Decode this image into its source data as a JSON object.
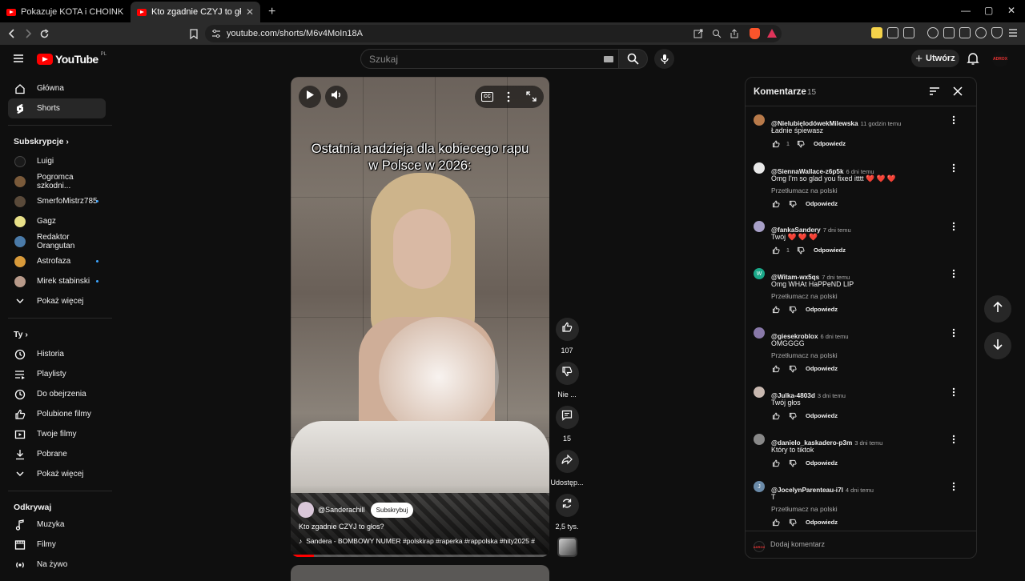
{
  "browser": {
    "tabs": [
      {
        "title": "Pokazuje KOTA i CHOINKĘ - YouTube"
      },
      {
        "title": "Kto zgadnie CZYJ to głos? - YouTube",
        "active": true
      }
    ],
    "url": "youtube.com/shorts/M6v4MoIn18A"
  },
  "header": {
    "logo_text": "YouTube",
    "logo_region": "PL",
    "search_placeholder": "Szukaj",
    "create_label": "Utwórz",
    "avatar_text": "ADROX"
  },
  "sidebar": {
    "main": [
      {
        "label": "Główna",
        "icon": "home-icon"
      },
      {
        "label": "Shorts",
        "icon": "shorts-icon",
        "active": true
      }
    ],
    "subs_heading": "Subskrypcje",
    "subscriptions": [
      {
        "label": "Luigi",
        "color": "#1a1a1a",
        "dot": false
      },
      {
        "label": "Pogromca szkodni...",
        "color": "#7a5a3a",
        "dot": false
      },
      {
        "label": "SmerfoMistrz785",
        "color": "#5a4a3a",
        "dot": true
      },
      {
        "label": "Gagz",
        "color": "#e8e088",
        "dot": false
      },
      {
        "label": "Redaktor Orangutan",
        "color": "#4a7aa8",
        "dot": false
      },
      {
        "label": "Astrofaza",
        "color": "#d89a3a",
        "dot": true
      },
      {
        "label": "Mirek stabinski",
        "color": "#b89a8a",
        "dot": true
      }
    ],
    "subs_more": "Pokaż więcej",
    "you_heading": "Ty",
    "you_items": [
      {
        "label": "Historia",
        "icon": "history-icon"
      },
      {
        "label": "Playlisty",
        "icon": "playlist-icon"
      },
      {
        "label": "Do obejrzenia",
        "icon": "watch-later-icon"
      },
      {
        "label": "Polubione filmy",
        "icon": "like-icon"
      },
      {
        "label": "Twoje filmy",
        "icon": "your-videos-icon"
      },
      {
        "label": "Pobrane",
        "icon": "download-icon"
      }
    ],
    "you_more": "Pokaż więcej",
    "explore_heading": "Odkrywaj",
    "explore_items": [
      {
        "label": "Muzyka",
        "icon": "music-icon"
      },
      {
        "label": "Filmy",
        "icon": "film-icon"
      },
      {
        "label": "Na żywo",
        "icon": "live-icon"
      }
    ]
  },
  "video": {
    "overlay_text": "Ostatnia nadzieja dla kobiecego rapu w Polsce w 2026:",
    "channel": "@Sanderachill",
    "subscribe_label": "Subskrybuj",
    "caption": "Kto zgadnie CZYJ to głos?",
    "music": "Sandera - BOMBOWY NUMER #polskirap #raperka #rappolska #hity2025 #",
    "progress": 0.09
  },
  "actions": {
    "likes": "107",
    "dislike_label": "Nie ...",
    "comments": "15",
    "share_label": "Udostęp...",
    "remix_label": "2,5 tys."
  },
  "comments_panel": {
    "title": "Komentarze",
    "count": "15",
    "input_placeholder": "Dodaj komentarz",
    "reply_label": "Odpowiedz",
    "translate_label": "Przetłumacz na polski",
    "items": [
      {
        "author": "@NielubięlodówekMilewska",
        "time": "11 godzin temu",
        "text": "Ładnie śpiewasz",
        "translate": false,
        "likes": "1",
        "avatar_color": "#b87a4a",
        "avatar_letter": ""
      },
      {
        "author": "@SiennaWallace-z6p5k",
        "time": "6 dni temu",
        "text": "Omg I'm so glad you fixed itttt ❤️ ❤️ ❤️",
        "translate": true,
        "likes": "",
        "avatar_color": "#e8e8e8",
        "avatar_letter": ""
      },
      {
        "author": "@fankaSandery",
        "time": "7 dni temu",
        "text": "Twój ❤️ ❤️ ❤️",
        "translate": false,
        "likes": "1",
        "avatar_color": "#a8a0c8",
        "avatar_letter": ""
      },
      {
        "author": "@Witam-wx5qs",
        "time": "7 dni temu",
        "text": "Omg WHAt HaPPeND LIP",
        "translate": true,
        "likes": "",
        "avatar_color": "#1aa889",
        "avatar_letter": "W"
      },
      {
        "author": "@giesekroblox",
        "time": "6 dni temu",
        "text": "OMGGGG",
        "translate": true,
        "likes": "",
        "avatar_color": "#8878a8",
        "avatar_letter": ""
      },
      {
        "author": "@Julka-4803d",
        "time": "3 dni temu",
        "text": "Twój głos",
        "translate": false,
        "likes": "",
        "avatar_color": "#c8b8b0",
        "avatar_letter": ""
      },
      {
        "author": "@danielo_kaskadero-p3m",
        "time": "3 dni temu",
        "text": "Który to tiktok",
        "translate": false,
        "likes": "",
        "avatar_color": "#888888",
        "avatar_letter": ""
      },
      {
        "author": "@JocelynParenteau-i7l",
        "time": "4 dni temu",
        "text": "T",
        "translate": true,
        "likes": "",
        "avatar_color": "#6a8aa8",
        "avatar_letter": "J"
      }
    ]
  }
}
